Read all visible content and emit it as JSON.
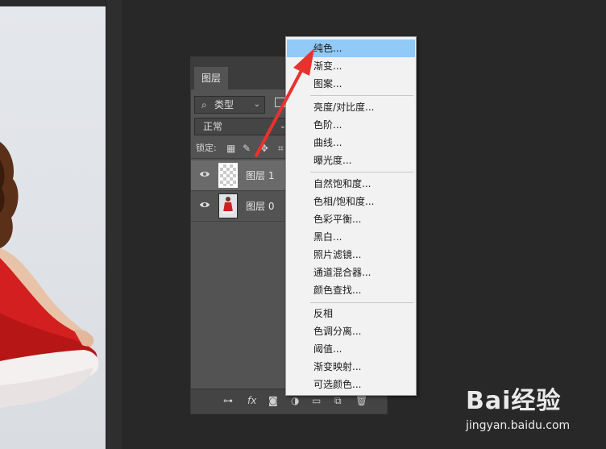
{
  "panel": {
    "tab": "图层",
    "filter": {
      "icon": "search-icon",
      "label": "类型"
    },
    "blend_mode": "正常",
    "lock_label": "锁定:",
    "layers": [
      {
        "name": "图层 1",
        "selected": true,
        "thumbnail": "transparent-checkerboard"
      },
      {
        "name": "图层 0",
        "selected": false,
        "thumbnail": "photo-woman-red-dress"
      }
    ],
    "bottom_icons": [
      "link-icon",
      "fx-icon",
      "mask-icon",
      "adjustment-layer-icon",
      "group-icon",
      "new-layer-icon",
      "trash-icon"
    ]
  },
  "bottom": {
    "fx": "fx"
  },
  "menu": {
    "groups": [
      [
        "纯色...",
        "渐变...",
        "图案..."
      ],
      [
        "亮度/对比度...",
        "色阶...",
        "曲线...",
        "曝光度..."
      ],
      [
        "自然饱和度...",
        "色相/饱和度...",
        "色彩平衡...",
        "黑白...",
        "照片滤镜...",
        "通道混合器...",
        "颜色查找..."
      ],
      [
        "反相",
        "色调分离...",
        "阈值...",
        "渐变映射...",
        "可选颜色..."
      ]
    ],
    "highlighted": "纯色..."
  },
  "colors": {
    "workspace": "#282828",
    "panel": "#535353",
    "menu_bg": "#f2f2f2",
    "menu_highlight": "#91c9f7",
    "arrow": "#e8322e",
    "dress": "#d31f1f"
  },
  "watermark": {
    "brand": "Bai经验",
    "url": "jingyan.baidu.com"
  }
}
